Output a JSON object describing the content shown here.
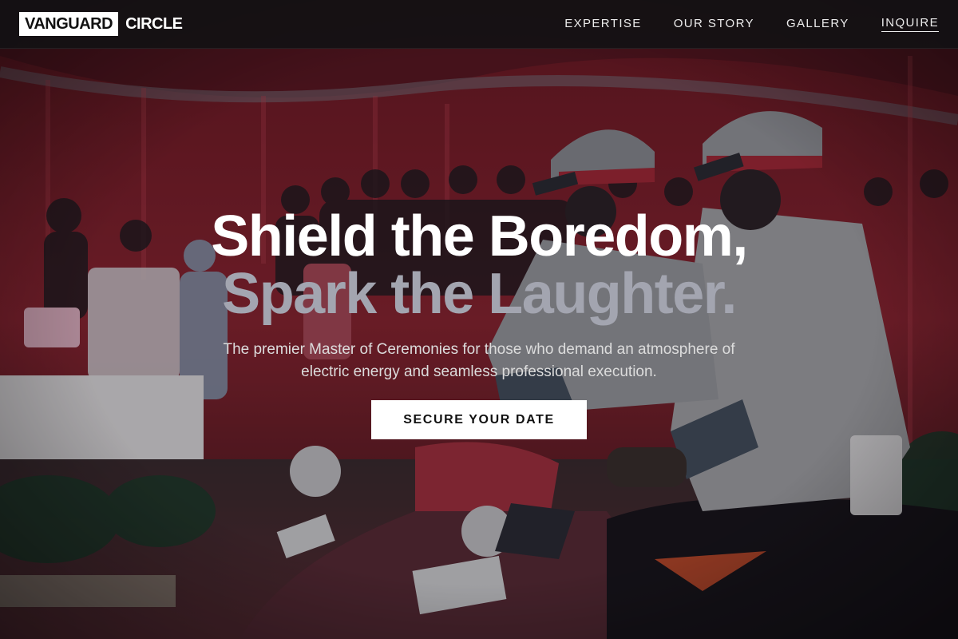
{
  "brand": {
    "logo_box_text": "VANGUARD",
    "logo_rest_text": "CIRCLE"
  },
  "nav": {
    "items": [
      {
        "label": "EXPERTISE"
      },
      {
        "label": "OUR STORY"
      },
      {
        "label": "GALLERY"
      },
      {
        "label": "INQUIRE",
        "active": true
      }
    ]
  },
  "hero": {
    "title_line_1": "Shield the Boredom,",
    "title_line_2": "Spark the Laughter.",
    "subtitle": "The premier Master of Ceremonies for those who demand an atmosphere of electric energy and seamless professional execution.",
    "cta_label": "SECURE YOUR DATE",
    "background_image": "police-motorcycle-parade-photo"
  },
  "colors": {
    "nav_bg": "#121113",
    "accent_white": "#ffffff",
    "title_secondary": "#a3a5b0",
    "tent_red": "#8a1f2a"
  }
}
